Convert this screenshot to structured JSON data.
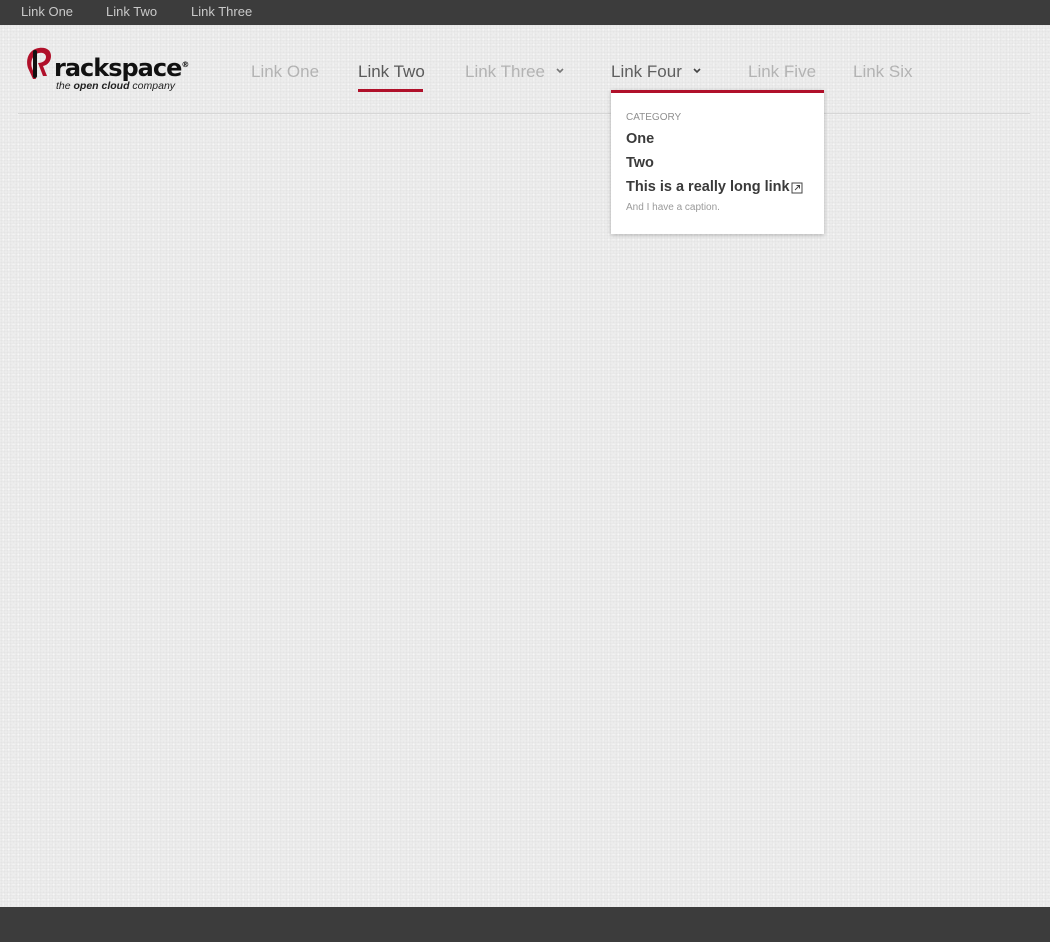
{
  "utility_nav": [
    "Link One",
    "Link Two",
    "Link Three"
  ],
  "logo": {
    "wordmark": "rackspace",
    "tagline_pre": "the ",
    "tagline_bold": "open cloud",
    "tagline_post": " company"
  },
  "main_nav": [
    "Link One",
    "Link Two",
    "Link Three",
    "Link Four",
    "Link Five",
    "Link Six"
  ],
  "active_item": "Link Two",
  "dropdown": {
    "category": "CATEGORY",
    "items": [
      "One",
      "Two",
      "This is a really long link"
    ],
    "caption": "And I have a caption."
  },
  "colors": {
    "accent": "#b0102a",
    "top_bar": "#3c3c3c",
    "background": "#ececec"
  }
}
